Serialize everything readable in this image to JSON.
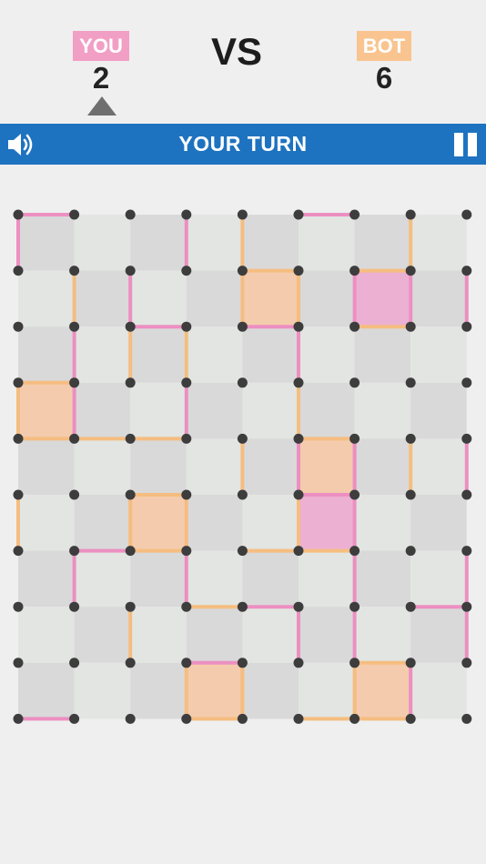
{
  "players": {
    "you": {
      "label": "YOU",
      "score": "2",
      "color": "#f29fc5"
    },
    "bot": {
      "label": "BOT",
      "score": "6",
      "color": "#f9c48f"
    }
  },
  "versus_label": "VS",
  "status": {
    "text": "YOUR TURN",
    "bar_color": "#1e73c0"
  },
  "icons": {
    "sound": "speaker-volume-icon",
    "pause": "pause-icon",
    "turn_indicator": "triangle-up-icon"
  },
  "colors": {
    "dot": "#3d3d3d",
    "cell_light": "#e2e5e1",
    "cell_dark": "#d9d9d9",
    "edge_you": "#ec8fc1",
    "edge_bot": "#f5bd80",
    "box_you": "#ecb0d2",
    "box_bot": "#f4cbad"
  },
  "board": {
    "cols": 8,
    "rows": 9,
    "h_edges": [
      {
        "r": 0,
        "c": 0,
        "p": "you"
      },
      {
        "r": 0,
        "c": 5,
        "p": "you"
      },
      {
        "r": 1,
        "c": 4,
        "p": "bot"
      },
      {
        "r": 1,
        "c": 6,
        "p": "bot"
      },
      {
        "r": 2,
        "c": 2,
        "p": "you"
      },
      {
        "r": 2,
        "c": 4,
        "p": "you"
      },
      {
        "r": 2,
        "c": 6,
        "p": "bot"
      },
      {
        "r": 3,
        "c": 0,
        "p": "bot"
      },
      {
        "r": 4,
        "c": 0,
        "p": "bot"
      },
      {
        "r": 4,
        "c": 1,
        "p": "bot"
      },
      {
        "r": 4,
        "c": 2,
        "p": "bot"
      },
      {
        "r": 4,
        "c": 5,
        "p": "bot"
      },
      {
        "r": 5,
        "c": 2,
        "p": "bot"
      },
      {
        "r": 5,
        "c": 5,
        "p": "you"
      },
      {
        "r": 6,
        "c": 1,
        "p": "you"
      },
      {
        "r": 6,
        "c": 2,
        "p": "bot"
      },
      {
        "r": 6,
        "c": 4,
        "p": "bot"
      },
      {
        "r": 6,
        "c": 5,
        "p": "bot"
      },
      {
        "r": 7,
        "c": 3,
        "p": "bot"
      },
      {
        "r": 7,
        "c": 4,
        "p": "you"
      },
      {
        "r": 7,
        "c": 7,
        "p": "you"
      },
      {
        "r": 8,
        "c": 3,
        "p": "you"
      },
      {
        "r": 8,
        "c": 6,
        "p": "bot"
      },
      {
        "r": 9,
        "c": 0,
        "p": "you"
      },
      {
        "r": 9,
        "c": 3,
        "p": "bot"
      },
      {
        "r": 9,
        "c": 5,
        "p": "bot"
      },
      {
        "r": 9,
        "c": 6,
        "p": "bot"
      }
    ],
    "v_edges": [
      {
        "r": 0,
        "c": 0,
        "p": "you"
      },
      {
        "r": 0,
        "c": 3,
        "p": "you"
      },
      {
        "r": 0,
        "c": 4,
        "p": "bot"
      },
      {
        "r": 0,
        "c": 7,
        "p": "bot"
      },
      {
        "r": 1,
        "c": 1,
        "p": "bot"
      },
      {
        "r": 1,
        "c": 2,
        "p": "you"
      },
      {
        "r": 1,
        "c": 4,
        "p": "bot"
      },
      {
        "r": 1,
        "c": 5,
        "p": "bot"
      },
      {
        "r": 1,
        "c": 6,
        "p": "you"
      },
      {
        "r": 1,
        "c": 7,
        "p": "you"
      },
      {
        "r": 1,
        "c": 8,
        "p": "you"
      },
      {
        "r": 2,
        "c": 1,
        "p": "you"
      },
      {
        "r": 2,
        "c": 2,
        "p": "bot"
      },
      {
        "r": 2,
        "c": 3,
        "p": "bot"
      },
      {
        "r": 2,
        "c": 5,
        "p": "you"
      },
      {
        "r": 3,
        "c": 0,
        "p": "bot"
      },
      {
        "r": 3,
        "c": 1,
        "p": "you"
      },
      {
        "r": 3,
        "c": 3,
        "p": "you"
      },
      {
        "r": 3,
        "c": 5,
        "p": "bot"
      },
      {
        "r": 4,
        "c": 4,
        "p": "bot"
      },
      {
        "r": 4,
        "c": 5,
        "p": "you"
      },
      {
        "r": 4,
        "c": 6,
        "p": "you"
      },
      {
        "r": 4,
        "c": 7,
        "p": "bot"
      },
      {
        "r": 4,
        "c": 8,
        "p": "you"
      },
      {
        "r": 5,
        "c": 0,
        "p": "bot"
      },
      {
        "r": 5,
        "c": 2,
        "p": "bot"
      },
      {
        "r": 5,
        "c": 3,
        "p": "bot"
      },
      {
        "r": 5,
        "c": 5,
        "p": "bot"
      },
      {
        "r": 5,
        "c": 6,
        "p": "you"
      },
      {
        "r": 6,
        "c": 1,
        "p": "you"
      },
      {
        "r": 6,
        "c": 3,
        "p": "you"
      },
      {
        "r": 6,
        "c": 6,
        "p": "you"
      },
      {
        "r": 6,
        "c": 8,
        "p": "you"
      },
      {
        "r": 7,
        "c": 2,
        "p": "bot"
      },
      {
        "r": 7,
        "c": 5,
        "p": "you"
      },
      {
        "r": 7,
        "c": 6,
        "p": "you"
      },
      {
        "r": 7,
        "c": 8,
        "p": "you"
      },
      {
        "r": 8,
        "c": 3,
        "p": "bot"
      },
      {
        "r": 8,
        "c": 4,
        "p": "bot"
      },
      {
        "r": 8,
        "c": 6,
        "p": "bot"
      },
      {
        "r": 8,
        "c": 7,
        "p": "you"
      }
    ],
    "boxes": [
      {
        "r": 1,
        "c": 4,
        "p": "bot"
      },
      {
        "r": 1,
        "c": 6,
        "p": "you"
      },
      {
        "r": 3,
        "c": 0,
        "p": "bot"
      },
      {
        "r": 4,
        "c": 5,
        "p": "bot"
      },
      {
        "r": 5,
        "c": 2,
        "p": "bot"
      },
      {
        "r": 5,
        "c": 5,
        "p": "you"
      },
      {
        "r": 8,
        "c": 3,
        "p": "bot"
      },
      {
        "r": 8,
        "c": 6,
        "p": "bot"
      }
    ]
  }
}
